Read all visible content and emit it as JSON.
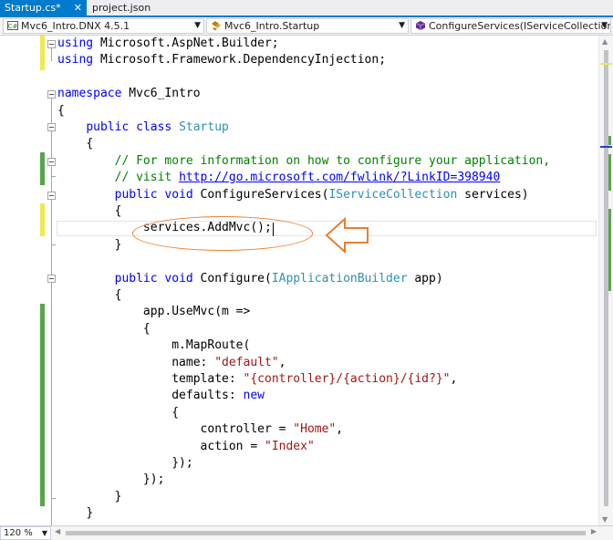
{
  "tabs": [
    {
      "label": "Startup.cs*",
      "close": "✕"
    },
    {
      "label": "project.json"
    }
  ],
  "navbar": {
    "project": "Mvc6_Intro.DNX 4.5.1",
    "type": "Mvc6_Intro.Startup",
    "member": "ConfigureServices(IServiceCollection ser"
  },
  "code": {
    "l1_kw": "using",
    "l1_rest": " Microsoft.AspNet.Builder;",
    "l2_kw": "using",
    "l2_rest": " Microsoft.Framework.DependencyInjection;",
    "l4_kw": "namespace",
    "l4_rest": " Mvc6_Intro",
    "l5": "{",
    "l6_kw": "public class",
    "l6_type": "Startup",
    "l7": "{",
    "l8": "// For more information on how to configure your application,",
    "l9_pre": "// visit ",
    "l9_link": "http://go.microsoft.com/fwlink/?LinkID=398940",
    "l10_kw": "public void",
    "l10_name": " ConfigureServices(",
    "l10_type": "IServiceCollection",
    "l10_rest": " services)",
    "l11": "{",
    "l12": "services.AddMvc();",
    "l13": "}",
    "l15_kw": "public void",
    "l15_name": " Configure(",
    "l15_type": "IApplicationBuilder",
    "l15_rest": " app)",
    "l16": "{",
    "l17": "app.UseMvc(m =>",
    "l18": "{",
    "l19": "m.MapRoute(",
    "l20_pre": "name: ",
    "l20_str": "\"default\"",
    "l20_post": ",",
    "l21_pre": "template: ",
    "l21_str": "\"{controller}/{action}/{id?}\"",
    "l21_post": ",",
    "l22_pre": "defaults: ",
    "l22_kw": "new",
    "l23": "{",
    "l24_pre": "controller = ",
    "l24_str": "\"Home\"",
    "l24_post": ",",
    "l25_pre": "action = ",
    "l25_str": "\"Index\"",
    "l26": "});",
    "l27": "});",
    "l28": "}",
    "l29": "}"
  },
  "zoom": "120 %",
  "colors": {
    "accent": "#007acc",
    "keyword": "#0000ff",
    "type": "#2b91af",
    "comment": "#008000",
    "string": "#a31515",
    "annotation": "#ed7d31",
    "change_saved": "#57a64a",
    "change_unsaved": "#efe94e"
  },
  "icons": {
    "project": "csharp-project-icon",
    "type": "class-icon",
    "member": "method-icon",
    "annotation": "left-arrow-icon"
  }
}
